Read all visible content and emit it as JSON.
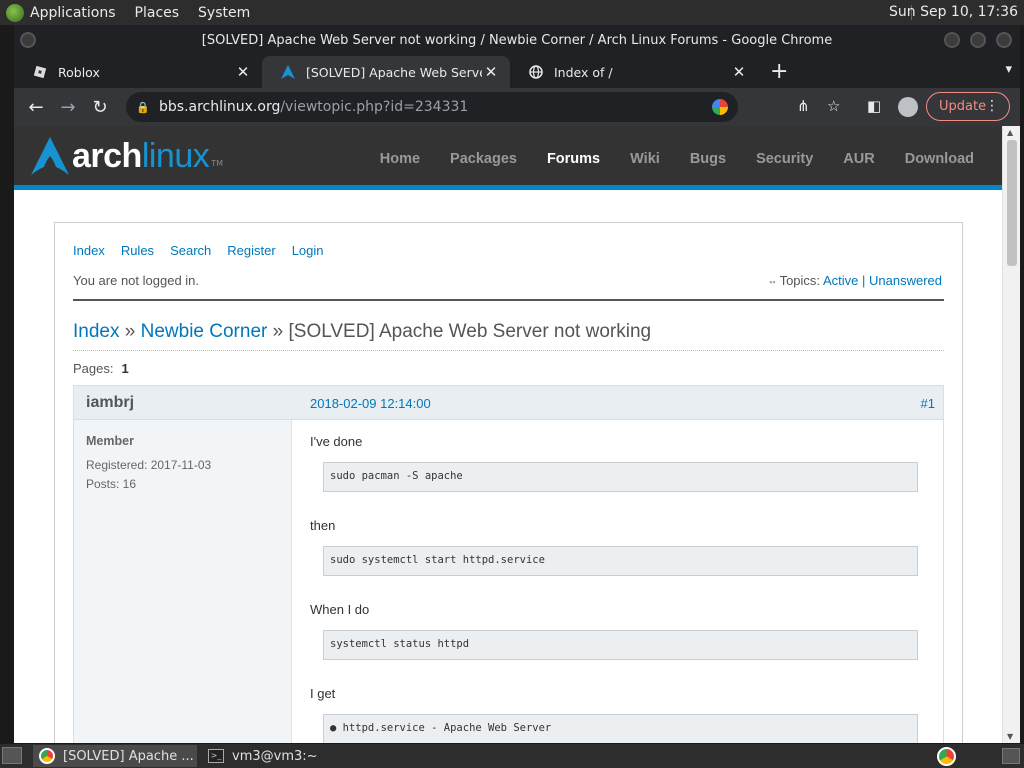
{
  "topbar": {
    "menus": [
      "Applications",
      "Places",
      "System"
    ],
    "clock": "Sun Sep 10, 17:36"
  },
  "window": {
    "title": "[SOLVED] Apache Web Server not working / Newbie Corner / Arch Linux Forums - Google Chrome"
  },
  "tabs": [
    {
      "title": "Roblox",
      "icon": "roblox-icon",
      "active": false
    },
    {
      "title": "[SOLVED] Apache Web Server not working",
      "icon": "arch-icon",
      "active": true
    },
    {
      "title": "Index of /",
      "icon": "globe-icon",
      "active": false
    }
  ],
  "omnibox": {
    "host": "bbs.archlinux.org",
    "path": "/viewtopic.php?id=234331"
  },
  "toolbar": {
    "update_label": "Update"
  },
  "arch": {
    "logo_bold": "arch",
    "logo_light": "linux",
    "logo_tm": "TM",
    "nav": [
      "Home",
      "Packages",
      "Forums",
      "Wiki",
      "Bugs",
      "Security",
      "AUR",
      "Download"
    ],
    "nav_current": "Forums"
  },
  "forum": {
    "menu": [
      "Index",
      "Rules",
      "Search",
      "Register",
      "Login"
    ],
    "login_status": "You are not logged in.",
    "topics_label": "Topics:",
    "topics_active": "Active",
    "topics_sep": "|",
    "topics_unanswered": "Unanswered",
    "crumbs": {
      "index": "Index",
      "sep": "»",
      "forum": "Newbie Corner",
      "topic": "[SOLVED] Apache Web Server not working"
    },
    "pages_label": "Pages:",
    "pages_current": "1"
  },
  "post": {
    "author": "iambrj",
    "date": "2018-02-09 12:14:00",
    "number": "#1",
    "role": "Member",
    "registered": "Registered: 2017-11-03",
    "posts": "Posts: 16",
    "body": [
      {
        "type": "text",
        "value": "I've done"
      },
      {
        "type": "code",
        "value": "sudo pacman -S apache"
      },
      {
        "type": "text",
        "value": "then"
      },
      {
        "type": "code",
        "value": "sudo systemctl start httpd.service"
      },
      {
        "type": "text",
        "value": "When I do"
      },
      {
        "type": "code",
        "value": "systemctl status httpd"
      },
      {
        "type": "text",
        "value": "I get"
      },
      {
        "type": "code",
        "value": "● httpd.service - Apache Web Server"
      }
    ]
  },
  "taskbar": {
    "tasks": [
      {
        "label": "[SOLVED] Apache ...",
        "icon": "chrome-icon"
      },
      {
        "label": "vm3@vm3:~",
        "icon": "terminal-icon"
      }
    ]
  }
}
